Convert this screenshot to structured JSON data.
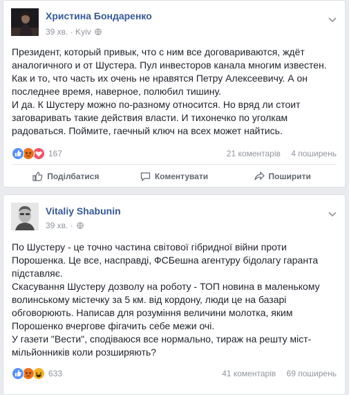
{
  "posts": [
    {
      "author": "Христина Бондаренко",
      "time": "39 хв.",
      "location": "Kyiv",
      "paragraphs": [
        "Президент, который привык, что с ним все договариваются, ждёт аналогичного и от Шустера. Пул инвесторов канала многим известен. Как и то, что часть их очень не нравятся Петру Алексеевичу. А он последнее время, наверное, полюбил тишину.",
        "И да. К Шустеру можно по-разному относится. Но вряд ли стоит заговаривать такие действия власти. И тихонечко по уголкам радоваться. Поймите, гаечный ключ на всех может найтись."
      ],
      "reaction_count": "167",
      "reaction_icons": [
        "like-icon",
        "angry-icon",
        "love-icon"
      ],
      "comments": "21 коментарів",
      "shares": "4 поширень",
      "actions": {
        "share": "Поділбатися",
        "comment": "Коментувати",
        "repost": "Поширити"
      }
    },
    {
      "author": "Vitaliy Shabunin",
      "time": "39 хв.",
      "location": "",
      "paragraphs": [
        "По Шустеру - це точно частина світової гібридної війни проти Порошенка. Це все, насправді, ФСБешна агентуру бідолагу гаранта підставляє.",
        "Скасування Шустеру дозволу на роботу - ТОП новина в маленькому волинському містечку за 5 км. від кордону, люди це на базарі обговорюють. Написав для розуміння величини молотка, яким Порошенко вчергове фігачить себе межи очі.",
        "У газети \"Вести\", сподіваюся все нормально, тираж на решту міст-мільйонників коли розширяють?"
      ],
      "reaction_count": "633",
      "reaction_icons": [
        "like-icon",
        "angry-icon",
        "haha-icon"
      ],
      "comments": "41 коментарів",
      "shares": "69 поширень"
    }
  ],
  "colors": {
    "link": "#365899",
    "meta": "#90949c",
    "like": "#5890ff",
    "angry": "#e9710f",
    "love": "#f25268",
    "haha": "#f7b125"
  }
}
